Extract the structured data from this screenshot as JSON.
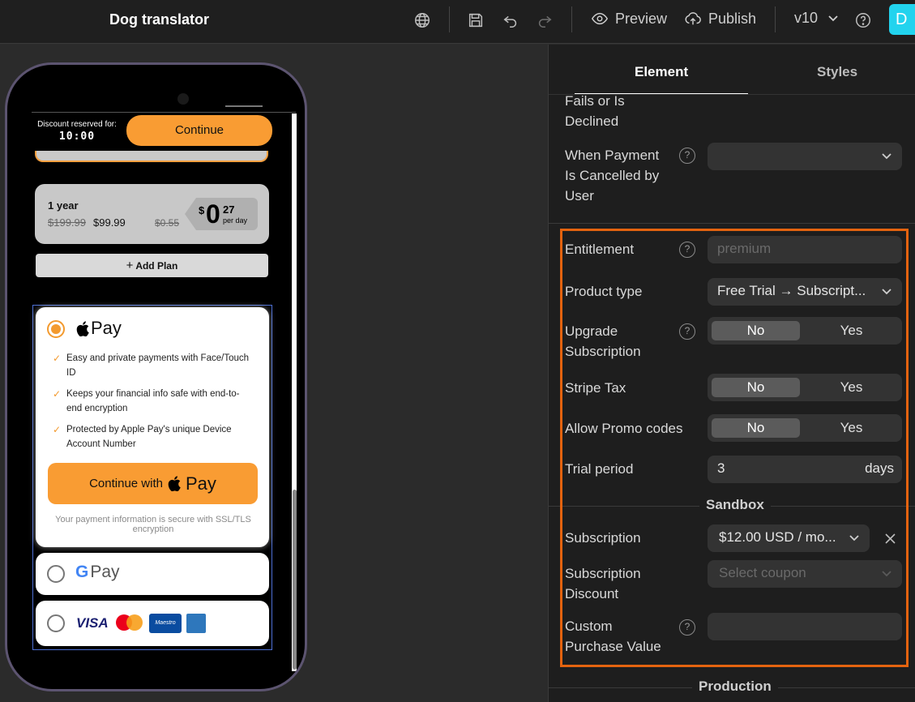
{
  "app": {
    "title": "Dog translator",
    "version": "v10",
    "avatar_letter": "D",
    "avatar_color": "#22d3ee"
  },
  "toolbar": {
    "preview_label": "Preview",
    "publish_label": "Publish"
  },
  "phone": {
    "discount_label": "Discount reserved for:",
    "timer": "10:00",
    "continue_label": "Continue",
    "plan": {
      "name": "1 year",
      "old_price": "$199.99",
      "new_price": "$99.99",
      "old_daily": "$0.55",
      "currency": "$",
      "daily_main": "0",
      "daily_cents": "27",
      "per_day": "per day"
    },
    "add_plan_label": "Add Plan",
    "apple_pay": {
      "logo_text": "Pay",
      "benefits": [
        "Easy and private payments with Face/Touch ID",
        "Keeps your financial info safe with end-to-end encryption",
        "Protected by Apple Pay's unique Device Account Number"
      ],
      "button_prefix": "Continue with",
      "button_logo_text": "Pay",
      "secure_note": "Your payment information is secure with SSL/TLS encryption"
    },
    "google_pay": {
      "logo_g": "G",
      "logo_text": "Pay"
    },
    "cards": {
      "visa": "VISA",
      "maestro": "Maestro"
    }
  },
  "panel": {
    "tabs": [
      "Element",
      "Styles"
    ],
    "partial_label": "Fails or Is Declined",
    "on_cancel_label": "When Payment Is Cancelled by User",
    "entitlement": {
      "label": "Entitlement",
      "placeholder": "premium"
    },
    "product_type": {
      "label": "Product type",
      "value": "Free Trial → Subscript..."
    },
    "upgrade": {
      "label": "Upgrade Subscription",
      "no": "No",
      "yes": "Yes"
    },
    "stripe_tax": {
      "label": "Stripe Tax",
      "no": "No",
      "yes": "Yes"
    },
    "promo": {
      "label": "Allow Promo codes",
      "no": "No",
      "yes": "Yes"
    },
    "trial": {
      "label": "Trial period",
      "value": "3",
      "unit": "days"
    },
    "sandbox_title": "Sandbox",
    "subscription": {
      "label": "Subscription",
      "value": "$12.00 USD / mo..."
    },
    "discount": {
      "label": "Subscription Discount",
      "placeholder": "Select coupon"
    },
    "custom_value": {
      "label": "Custom Purchase Value"
    },
    "production_title": "Production",
    "highlight_color": "#e4630f"
  }
}
